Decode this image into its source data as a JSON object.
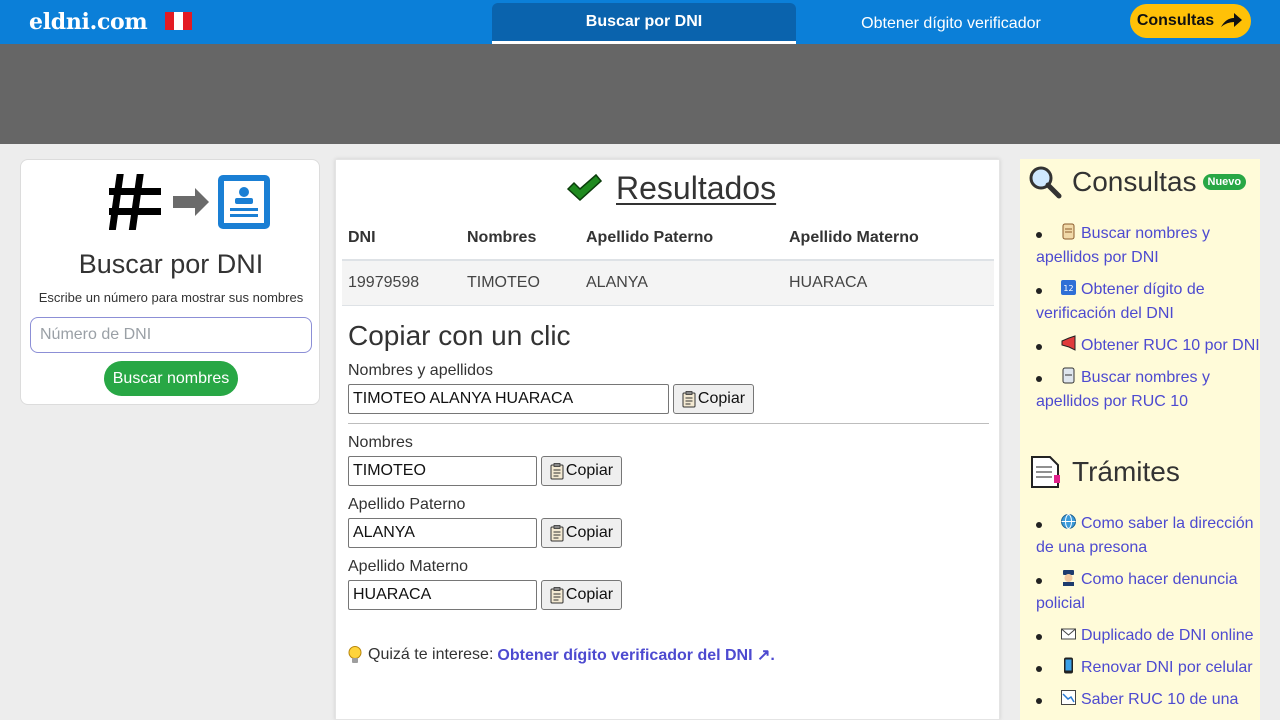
{
  "header": {
    "logo": "eldni.com",
    "nav_active": "Buscar por DNI",
    "nav_link": "Obtener dígito verificador",
    "consultas_button": "Consultas"
  },
  "search_card": {
    "title": "Buscar por DNI",
    "subtitle": "Escribe un número para mostrar sus nombres",
    "input_placeholder": "Número de DNI",
    "button": "Buscar nombres"
  },
  "results": {
    "title": "Resultados",
    "columns": [
      "DNI",
      "Nombres",
      "Apellido Paterno",
      "Apellido Materno"
    ],
    "row": [
      "19979598",
      "TIMOTEO",
      "ALANYA",
      "HUARACA"
    ]
  },
  "copy": {
    "title": "Copiar con un clic",
    "button": "Copiar",
    "fields": [
      {
        "label": "Nombres y apellidos",
        "value": "TIMOTEO ALANYA HUARACA"
      },
      {
        "label": "Nombres",
        "value": "TIMOTEO"
      },
      {
        "label": "Apellido Paterno",
        "value": "ALANYA"
      },
      {
        "label": "Apellido Materno",
        "value": "HUARACA"
      }
    ]
  },
  "tip": {
    "prefix": "Quizá te interese:",
    "link": "Obtener dígito verificador del DNI ↗."
  },
  "sidebar": {
    "consultas_title": "Consultas",
    "consultas_badge": "Nuevo",
    "consultas_items": [
      {
        "icon": "scroll-icon",
        "label": "Buscar nombres y apellidos por DNI"
      },
      {
        "icon": "numbers-icon",
        "label": "Obtener dígito de verificación del DNI"
      },
      {
        "icon": "megaphone-icon",
        "label": "Obtener RUC 10 por DNI"
      },
      {
        "icon": "id-card-icon",
        "label": "Buscar nombres y apellidos por RUC 10"
      }
    ],
    "tramites_title": "Trámites",
    "tramites_items": [
      {
        "icon": "globe-icon",
        "label": "Como saber la dirección de una presona"
      },
      {
        "icon": "police-icon",
        "label": "Como hacer denuncia policial"
      },
      {
        "icon": "envelope-icon",
        "label": "Duplicado de DNI online"
      },
      {
        "icon": "phone-icon",
        "label": "Renovar DNI por celular"
      },
      {
        "icon": "chart-icon",
        "label": "Saber RUC 10 de una"
      }
    ]
  },
  "colors": {
    "topbar": "#0b7fd8",
    "nav_active": "#0a63ad",
    "consultas_button": "#ffc107",
    "search_button": "#28a745",
    "link": "#4d4ad0",
    "sidebar_bg": "#fffbd9"
  }
}
